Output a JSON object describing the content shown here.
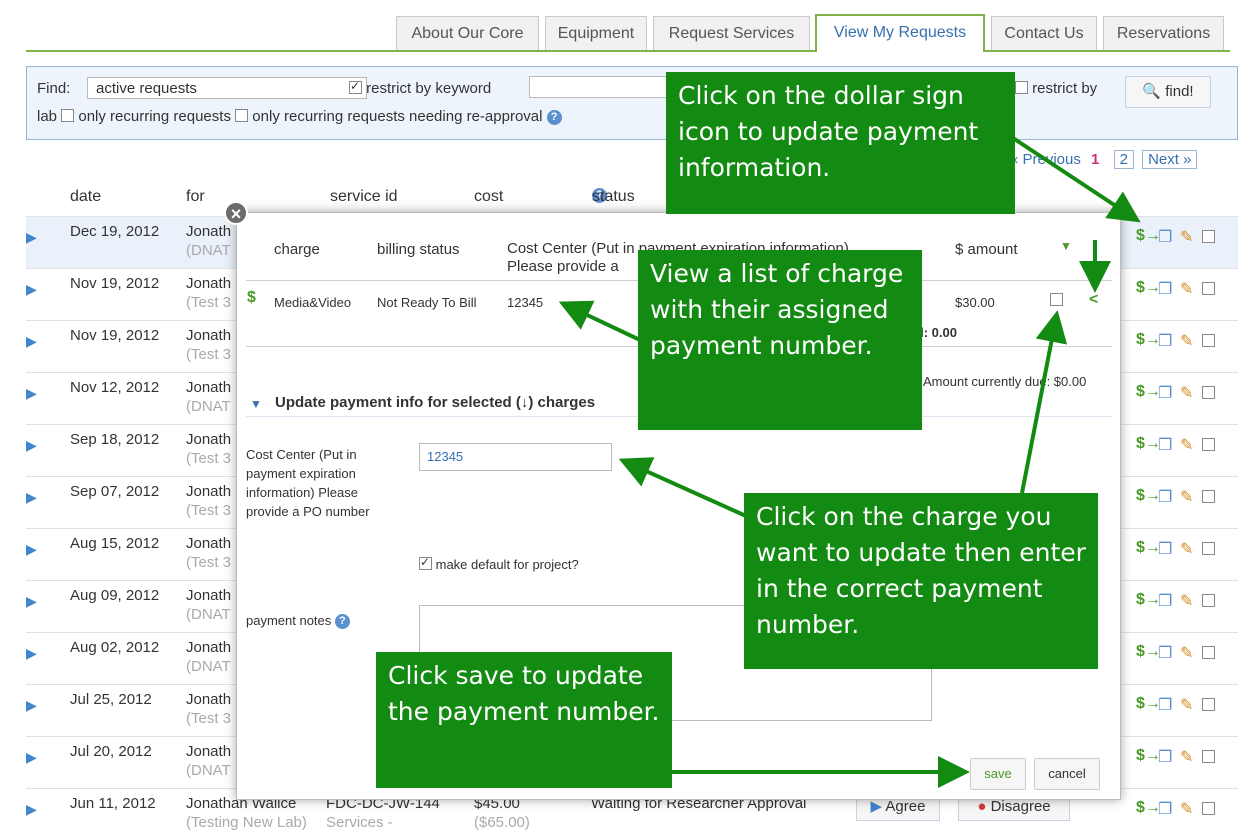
{
  "tabs": [
    {
      "label": "About Our Core"
    },
    {
      "label": "Equipment"
    },
    {
      "label": "Request Services"
    },
    {
      "label": "View My Requests"
    },
    {
      "label": "Contact Us"
    },
    {
      "label": "Reservations"
    }
  ],
  "search": {
    "find_label": "Find:",
    "filter_value": "active requests",
    "restrict_keyword": "restrict by keyword",
    "restrict_by": "restrict by",
    "lab": "lab",
    "only_recurring": "only recurring requests",
    "only_recurring_reapproval": "only recurring requests needing re-approval",
    "find_button": "find!"
  },
  "pager": {
    "previous": "« Previous",
    "current": "1",
    "page2": "2",
    "next": "Next »"
  },
  "columns": {
    "date": "date",
    "for": "for",
    "service_id": "service id",
    "cost": "cost",
    "status": "status"
  },
  "rows": [
    {
      "date": "Dec 19, 2012",
      "who": "Jonath",
      "sub": "(DNAT"
    },
    {
      "date": "Nov 19, 2012",
      "who": "Jonath",
      "sub": "(Test 3"
    },
    {
      "date": "Nov 19, 2012",
      "who": "Jonath",
      "sub": "(Test 3"
    },
    {
      "date": "Nov 12, 2012",
      "who": "Jonath",
      "sub": "(DNAT"
    },
    {
      "date": "Sep 18, 2012",
      "who": "Jonath",
      "sub": "(Test 3"
    },
    {
      "date": "Sep 07, 2012",
      "who": "Jonath",
      "sub": "(Test 3"
    },
    {
      "date": "Aug 15, 2012",
      "who": "Jonath",
      "sub": "(Test 3"
    },
    {
      "date": "Aug 09, 2012",
      "who": "Jonath",
      "sub": "(DNAT"
    },
    {
      "date": "Aug 02, 2012",
      "who": "Jonath",
      "sub": "(DNAT"
    },
    {
      "date": "Jul 25, 2012",
      "who": "Jonath",
      "sub": "(Test 3"
    },
    {
      "date": "Jul 20, 2012",
      "who": "Jonath",
      "sub": "(DNAT"
    },
    {
      "date": "Jun 11, 2012",
      "who": "Jonathan Wallce",
      "sub": "(Testing New Lab)",
      "service_id": "FDC-DC-JW-144",
      "service_sub": "Services -",
      "cost": "$45.00",
      "cost_sub": "($65.00)",
      "status": "Waiting for Researcher Approval",
      "agree": "Agree",
      "disagree": "Disagree"
    }
  ],
  "modal": {
    "close": "×",
    "col_charge": "charge",
    "col_billing": "billing status",
    "col_cost_center": "Cost Center (Put in payment expiration information)",
    "col_cost_center_2": "Please provide a",
    "col_amount": "$ amount",
    "charge_name": "Media&Video",
    "charge_status": "Not Ready To Bill",
    "charge_number": "12345",
    "charge_amount": "$30.00",
    "selected_total": "cted: 0.00",
    "amount_due": "Amount currently due: $0.00",
    "update_heading": "Update payment info for selected (↓) charges",
    "cc_label": "Cost Center (Put in payment expiration information) Please provide a PO number",
    "cc_value": "12345",
    "make_default": "make default for project?",
    "payment_notes": "payment notes",
    "save": "save",
    "cancel": "cancel"
  },
  "callouts": {
    "dollar": "Click on the dollar sign icon to update payment information.",
    "list": "View a list of charge with their assigned payment number.",
    "charge": "Click on the charge you want to update then enter in the correct payment number.",
    "save": "Click save to update the payment number."
  },
  "colors": {
    "accent_green": "#138a12",
    "tab_line": "#7fb24a",
    "link_blue": "#3670b0"
  }
}
